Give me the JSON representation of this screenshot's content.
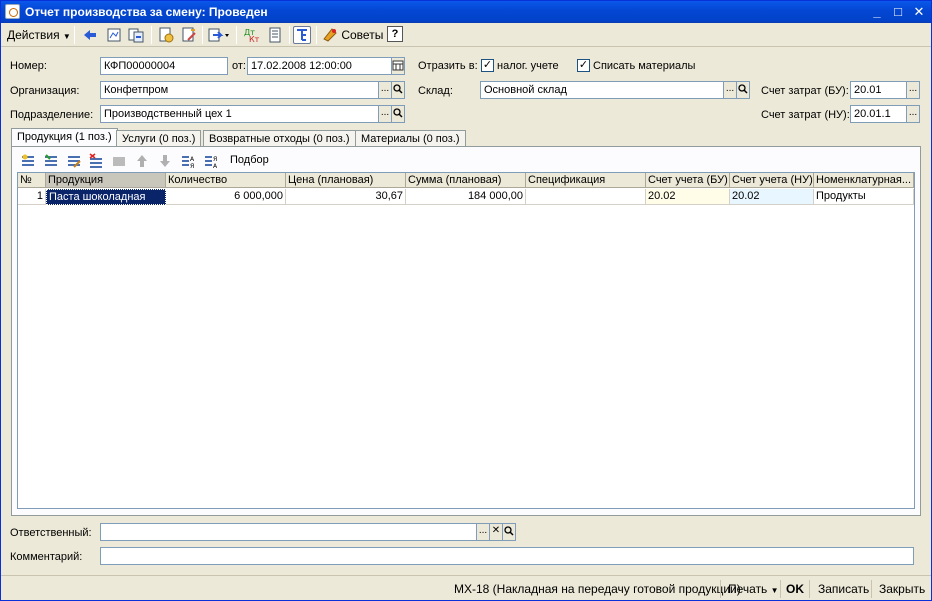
{
  "window": {
    "title": "Отчет производства за смену: Проведен"
  },
  "toolbar": {
    "actions_label": "Действия",
    "tips_label": "Советы",
    "help_label": "?"
  },
  "form": {
    "number_label": "Номер:",
    "number_value": "КФП00000004",
    "date_label": "от:",
    "date_value": "17.02.2008 12:00:00",
    "reflect_label": "Отразить в:",
    "tax_accounting_label": "налог. учете",
    "tax_accounting_checked": true,
    "writeoff_label": "Списать материалы",
    "writeoff_checked": true,
    "org_label": "Организация:",
    "org_value": "Конфетпром",
    "warehouse_label": "Склад:",
    "warehouse_value": "Основной склад",
    "cost_bu_label": "Счет затрат (БУ):",
    "cost_bu_value": "20.01",
    "division_label": "Подразделение:",
    "division_value": "Производственный цех 1",
    "cost_nu_label": "Счет затрат (НУ):",
    "cost_nu_value": "20.01.1",
    "responsible_label": "Ответственный:",
    "responsible_value": "",
    "comment_label": "Комментарий:",
    "comment_value": ""
  },
  "tabs": [
    {
      "label": "Продукция (1 поз.)",
      "active": true
    },
    {
      "label": "Услуги (0 поз.)",
      "active": false
    },
    {
      "label": "Возвратные отходы (0 поз.)",
      "active": false
    },
    {
      "label": "Материалы (0 поз.)",
      "active": false
    }
  ],
  "grid_toolbar": {
    "pick_label": "Подбор"
  },
  "table": {
    "columns": [
      "№",
      "Продукция",
      "Количество",
      "Цена (плановая)",
      "Сумма (плановая)",
      "Спецификация",
      "Счет учета (БУ)",
      "Счет учета (НУ)",
      "Номенклатурная..."
    ],
    "rows": [
      [
        "1",
        "Паста шоколадная",
        "6 000,000",
        "30,67",
        "184 000,00",
        "",
        "20.02",
        "20.02",
        "Продукты"
      ]
    ]
  },
  "bottom": {
    "print_form_label": "МХ-18 (Накладная на передачу готовой продукции)",
    "print_label": "Печать",
    "ok_label": "OK",
    "save_label": "Записать",
    "close_label": "Закрыть"
  },
  "colors": {
    "titlebar": "#0a58ea",
    "selection": "#0a246a",
    "bu_tint": "#fffde8",
    "nu_tint": "#e8f6ff"
  }
}
